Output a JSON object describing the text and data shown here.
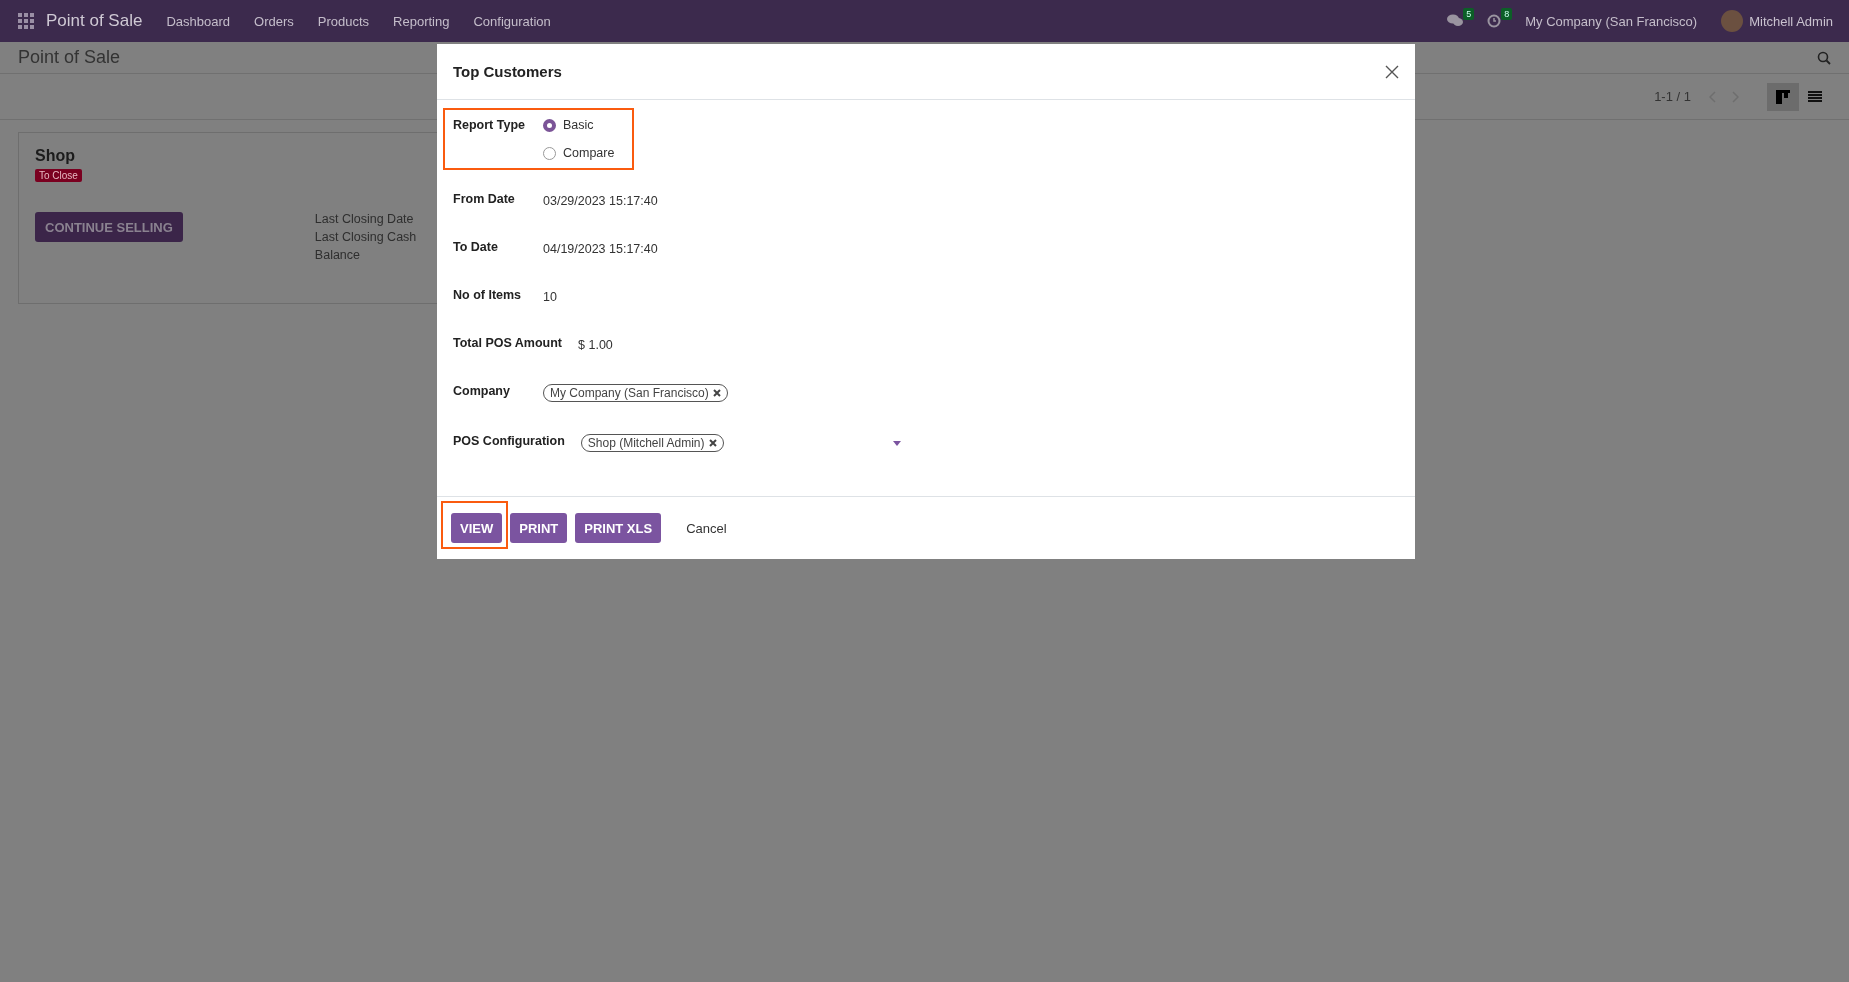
{
  "navbar": {
    "app_name": "Point of Sale",
    "menu": [
      "Dashboard",
      "Orders",
      "Products",
      "Reporting",
      "Configuration"
    ],
    "messages_count": "5",
    "activities_count": "8",
    "company": "My Company (San Francisco)",
    "user": "Mitchell Admin"
  },
  "control_panel": {
    "breadcrumb": "Point of Sale",
    "pager": "1-1 / 1",
    "views": [
      {
        "kind": "kanban",
        "selected": true
      },
      {
        "kind": "list",
        "selected": false
      }
    ]
  },
  "card": {
    "title": "Shop",
    "status": "To Close",
    "action": "CONTINUE SELLING",
    "info": [
      "Last Closing Date",
      "Last Closing Cash",
      "Balance"
    ]
  },
  "dialog": {
    "title": "Top Customers",
    "fields": [
      {
        "kind": "radio",
        "label": "Report Type",
        "highlighted": true,
        "options": [
          {
            "label": "Basic",
            "selected": true
          },
          {
            "label": "Compare",
            "selected": false
          }
        ]
      },
      {
        "kind": "text",
        "label": "From Date",
        "value": "03/29/2023 15:17:40"
      },
      {
        "kind": "text",
        "label": "To Date",
        "value": "04/19/2023 15:17:40"
      },
      {
        "kind": "text",
        "label": "No of Items",
        "value": "10"
      },
      {
        "kind": "text",
        "label": "Total POS Amount",
        "value": "$ 1.00"
      },
      {
        "kind": "tags",
        "label": "Company",
        "tags": [
          "My Company (San Francisco)"
        ]
      },
      {
        "kind": "tags",
        "label": "POS Configuration",
        "tags": [
          "Shop (Mitchell Admin)"
        ],
        "dropdown": true
      }
    ],
    "buttons": [
      {
        "label": "VIEW",
        "kind": "primary",
        "highlighted": true
      },
      {
        "label": "PRINT",
        "kind": "primary",
        "highlighted": false
      },
      {
        "label": "PRINT XLS",
        "kind": "primary",
        "highlighted": false
      },
      {
        "label": "Cancel",
        "kind": "link",
        "highlighted": false
      }
    ]
  }
}
